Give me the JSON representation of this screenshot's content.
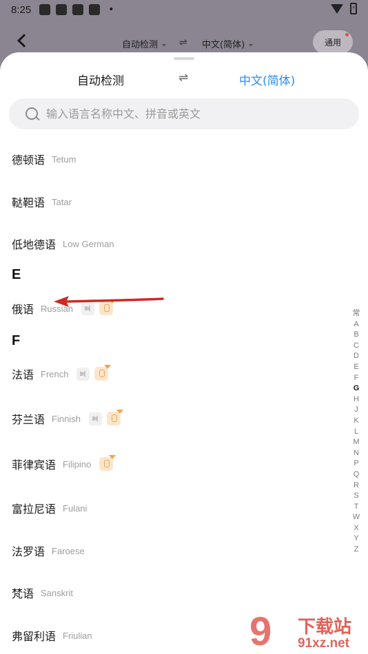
{
  "status_bar": {
    "time": "8:25",
    "battery": "⚡"
  },
  "top_nav": {
    "source_lang": "自动检测",
    "swap": "⇌",
    "target_lang": "中文(简体)",
    "general_button": "通用"
  },
  "sheet": {
    "source_lang": "自动检测",
    "swap": "⇌",
    "target_lang": "中文(简体)",
    "target_color": "#2b8cf0",
    "search": {
      "placeholder": "输入语言名称中文、拼音或英文",
      "value": ""
    }
  },
  "languages": {
    "d_group": [
      {
        "zh": "德顿语",
        "en": "Tetum"
      },
      {
        "zh": "鞑靼语",
        "en": "Tatar"
      },
      {
        "zh": "低地德语",
        "en": "Low German"
      }
    ],
    "e_header": "E",
    "e_group": [
      {
        "zh": "俄语",
        "en": "Russian"
      }
    ],
    "f_header": "F",
    "f_group": [
      {
        "zh": "法语",
        "en": "French"
      },
      {
        "zh": "芬兰语",
        "en": "Finnish"
      },
      {
        "zh": "菲律宾语",
        "en": "Filipino"
      },
      {
        "zh": "富拉尼语",
        "en": "Fulani"
      },
      {
        "zh": "法罗语",
        "en": "Faroese"
      },
      {
        "zh": "梵语",
        "en": "Sanskrit"
      },
      {
        "zh": "弗留利语",
        "en": "Friulian"
      }
    ]
  },
  "alpha_index": [
    "常",
    "A",
    "B",
    "C",
    "D",
    "E",
    "F",
    "G",
    "H",
    "J",
    "K",
    "L",
    "M",
    "N",
    "P",
    "Q",
    "R",
    "S",
    "T",
    "W",
    "X",
    "Y",
    "Z"
  ],
  "alpha_active": "G",
  "watermark": {
    "logo": "9",
    "name": "下载站",
    "url": "91xz.net"
  }
}
